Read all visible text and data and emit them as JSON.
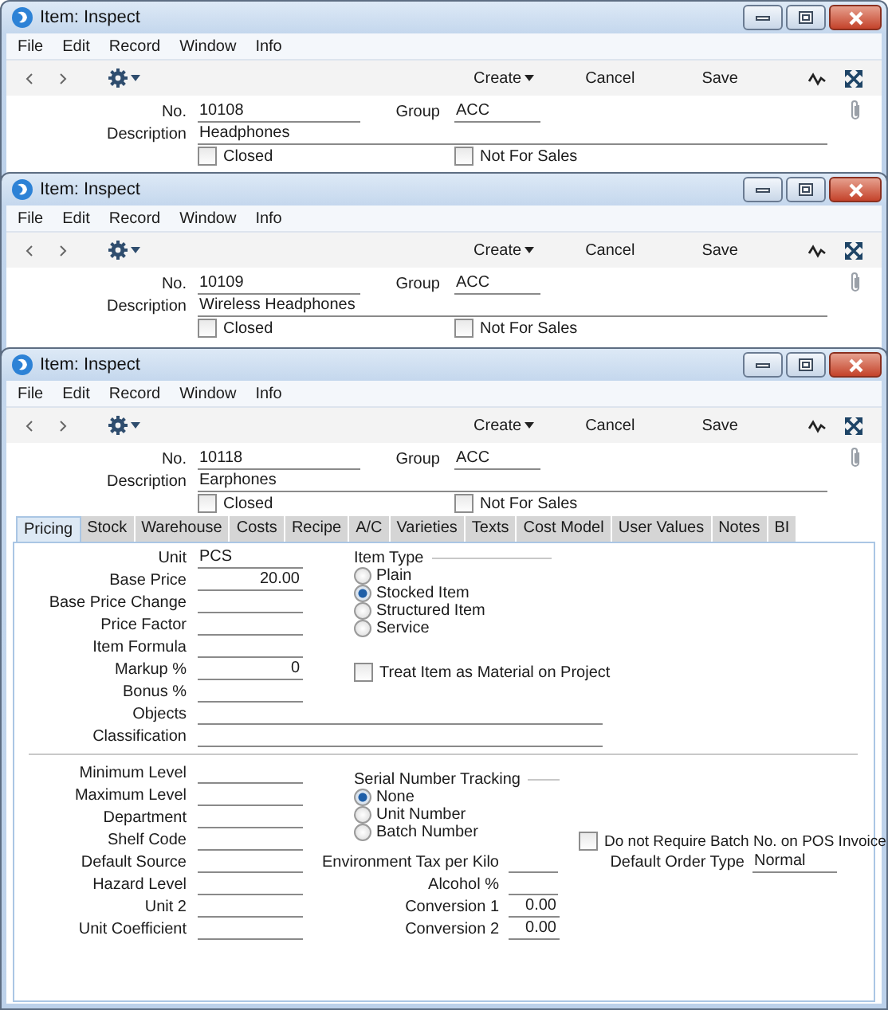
{
  "windows": [
    {
      "title": "Item: Inspect",
      "menu": [
        "File",
        "Edit",
        "Record",
        "Window",
        "Info"
      ],
      "toolbar": {
        "create": "Create",
        "cancel": "Cancel",
        "save": "Save"
      },
      "record": {
        "no_label": "No.",
        "no": "10108",
        "group_label": "Group",
        "group": "ACC",
        "description_label": "Description",
        "description": "Headphones",
        "closed": {
          "label": "Closed",
          "checked": false
        },
        "not_for_sales": {
          "label": "Not For Sales",
          "checked": false
        }
      }
    },
    {
      "title": "Item: Inspect",
      "menu": [
        "File",
        "Edit",
        "Record",
        "Window",
        "Info"
      ],
      "toolbar": {
        "create": "Create",
        "cancel": "Cancel",
        "save": "Save"
      },
      "record": {
        "no_label": "No.",
        "no": "10109",
        "group_label": "Group",
        "group": "ACC",
        "description_label": "Description",
        "description": "Wireless Headphones",
        "closed": {
          "label": "Closed",
          "checked": false
        },
        "not_for_sales": {
          "label": "Not For Sales",
          "checked": false
        }
      }
    },
    {
      "title": "Item: Inspect",
      "menu": [
        "File",
        "Edit",
        "Record",
        "Window",
        "Info"
      ],
      "toolbar": {
        "create": "Create",
        "cancel": "Cancel",
        "save": "Save"
      },
      "record": {
        "no_label": "No.",
        "no": "10118",
        "group_label": "Group",
        "group": "ACC",
        "description_label": "Description",
        "description": "Earphones",
        "closed": {
          "label": "Closed",
          "checked": false
        },
        "not_for_sales": {
          "label": "Not For Sales",
          "checked": false
        }
      },
      "tabs": [
        {
          "label": "Pricing",
          "selected": true
        },
        {
          "label": "Stock",
          "selected": false
        },
        {
          "label": "Warehouse",
          "selected": false
        },
        {
          "label": "Costs",
          "selected": false
        },
        {
          "label": "Recipe",
          "selected": false
        },
        {
          "label": "A/C",
          "selected": false
        },
        {
          "label": "Varieties",
          "selected": false
        },
        {
          "label": "Texts",
          "selected": false
        },
        {
          "label": "Cost Model",
          "selected": false
        },
        {
          "label": "User Values",
          "selected": false
        },
        {
          "label": "Notes",
          "selected": false
        },
        {
          "label": "BI",
          "selected": false
        }
      ],
      "tab_panel": {
        "left_fields": [
          {
            "label": "Unit",
            "value": "PCS",
            "kind": "text"
          },
          {
            "label": "Base Price",
            "value": "20.00",
            "kind": "amount"
          },
          {
            "label": "Base Price Change",
            "kind": "text"
          },
          {
            "label": "Price Factor",
            "kind": "text"
          },
          {
            "label": "Item Formula",
            "kind": "text"
          },
          {
            "label": "Markup %",
            "value": "0",
            "kind": "amount"
          },
          {
            "label": "Bonus %",
            "kind": "text"
          }
        ],
        "wide_fields": [
          {
            "label": "Objects"
          },
          {
            "label": "Classification"
          }
        ],
        "item_type": {
          "label": "Item Type",
          "options": [
            {
              "label": "Plain",
              "selected": false
            },
            {
              "label": "Stocked Item",
              "selected": true
            },
            {
              "label": "Structured Item",
              "selected": false
            },
            {
              "label": "Service",
              "selected": false
            }
          ]
        },
        "treat_as_material": {
          "label": "Treat Item as Material on Project",
          "checked": false
        },
        "lower_fields": [
          {
            "label": "Minimum Level"
          },
          {
            "label": "Maximum Level"
          },
          {
            "label": "Department"
          },
          {
            "label": "Shelf Code"
          },
          {
            "label": "Default Source"
          },
          {
            "label": "Hazard Level"
          },
          {
            "label": "Unit 2"
          },
          {
            "label": "Unit Coefficient"
          }
        ],
        "serial_tracking": {
          "label": "Serial Number Tracking",
          "options": [
            {
              "label": "None",
              "selected": true
            },
            {
              "label": "Unit Number",
              "selected": false
            },
            {
              "label": "Batch Number",
              "selected": false
            }
          ]
        },
        "no_batch_on_pos": {
          "label": "Do not Require Batch No. on POS Invoice",
          "checked": false
        },
        "middle_fields": [
          {
            "label": "Environment Tax per Kilo",
            "kind": "text"
          },
          {
            "label": "Alcohol %",
            "kind": "text"
          },
          {
            "label": "Conversion 1",
            "value": "0.00",
            "kind": "amount"
          },
          {
            "label": "Conversion 2",
            "value": "0.00",
            "kind": "amount"
          }
        ],
        "default_order_type": {
          "label": "Default Order Type",
          "value": "Normal"
        }
      }
    }
  ]
}
